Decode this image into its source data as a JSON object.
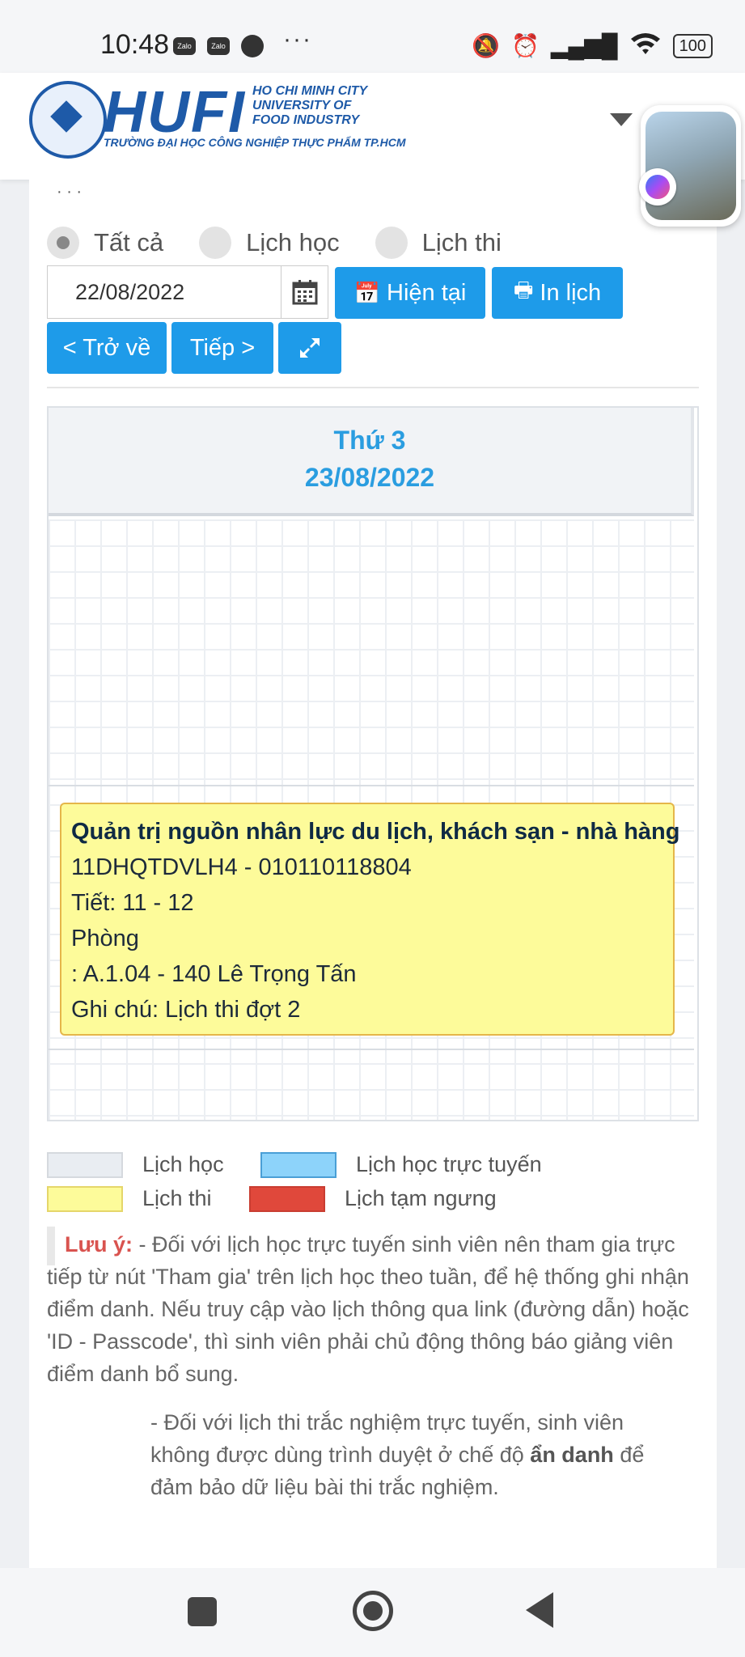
{
  "status_bar": {
    "time": "10:48",
    "app_icons": [
      "Zalo",
      "Zalo"
    ],
    "more": "···",
    "battery": "100"
  },
  "header": {
    "logo_name": "HUFI",
    "logo_sub": [
      "HO CHI MINH CITY",
      "UNIVERSITY OF",
      "FOOD INDUSTRY"
    ],
    "logo_vn": "TRƯỜNG ĐẠI HỌC CÔNG NGHIỆP THỰC PHẨM TP.HCM"
  },
  "filters": [
    {
      "label": "Tất cả",
      "selected": true
    },
    {
      "label": "Lịch học",
      "selected": false
    },
    {
      "label": "Lịch thi",
      "selected": false
    }
  ],
  "toolbar": {
    "date_value": "22/08/2022",
    "current_label": "Hiện tại",
    "print_label": "In lịch",
    "back_label": "< Trở về",
    "next_label": "Tiếp >"
  },
  "calendar": {
    "day_name": "Thứ 3",
    "date": "23/08/2022",
    "event": {
      "title": "Quản trị nguồn nhân lực du lịch, khách sạn - nhà hàng",
      "code": "11DHQTDVLH4 - 010110118804",
      "period": "Tiết: 11 - 12",
      "room_label": "Phòng",
      "room": ": A.1.04 - 140 Lê Trọng Tấn",
      "note": "Ghi chú: Lịch thi đợt 2"
    }
  },
  "legend": [
    {
      "label": "Lịch học",
      "color": "#e9edf2"
    },
    {
      "label": "Lịch học trực tuyến",
      "color": "#8dd3fa"
    },
    {
      "label": "Lịch thi",
      "color": "#fdfb9a"
    },
    {
      "label": "Lịch tạm ngưng",
      "color": "#e0483b"
    }
  ],
  "note": {
    "label": "Lưu ý:",
    "text1": " - Đối với lịch học trực tuyến sinh viên nên tham gia trực tiếp từ nút 'Tham gia' trên lịch học theo tuần, để hệ thống ghi nhận điểm danh. Nếu truy cập vào lịch thông qua link (đường dẫn) hoặc 'ID - Passcode', thì sinh viên phải chủ động thông báo giảng viên điểm danh bổ sung.",
    "text2_a": "- Đối với lịch thi trắc nghiệm trực tuyến, sinh viên không được dùng trình duyệt ở chế độ ",
    "text2_bold": "ẩn danh",
    "text2_b": " để đảm bảo dữ liệu bài thi trắc nghiệm."
  }
}
